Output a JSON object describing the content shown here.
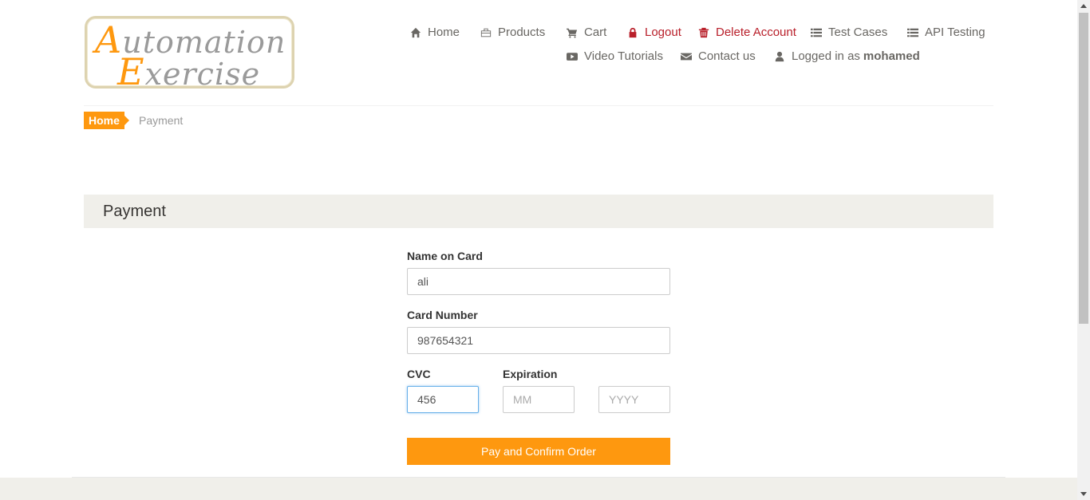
{
  "logo": {
    "line1_cap": "A",
    "line1_rest": "utomation",
    "line2_cap": "E",
    "line2_rest": "xercise"
  },
  "nav": {
    "home": "Home",
    "products": "Products",
    "cart": "Cart",
    "logout": "Logout",
    "delete_account": "Delete Account",
    "test_cases": "Test Cases",
    "api_testing": "API Testing",
    "video_tutorials": "Video Tutorials",
    "contact_us": "Contact us",
    "logged_in_prefix": "Logged in as",
    "username": "mohamed"
  },
  "breadcrumb": {
    "home": "Home",
    "current": "Payment"
  },
  "payment": {
    "title": "Payment",
    "name_label": "Name on Card",
    "name_value": "ali",
    "card_label": "Card Number",
    "card_value": "987654321",
    "cvc_label": "CVC",
    "cvc_value": "456",
    "expiration_label": "Expiration",
    "month_placeholder": "MM",
    "year_placeholder": "YYYY",
    "submit_label": "Pay and Confirm Order"
  },
  "colors": {
    "accent": "#fe980f",
    "danger": "#b9202b",
    "panel": "#f0efea"
  }
}
